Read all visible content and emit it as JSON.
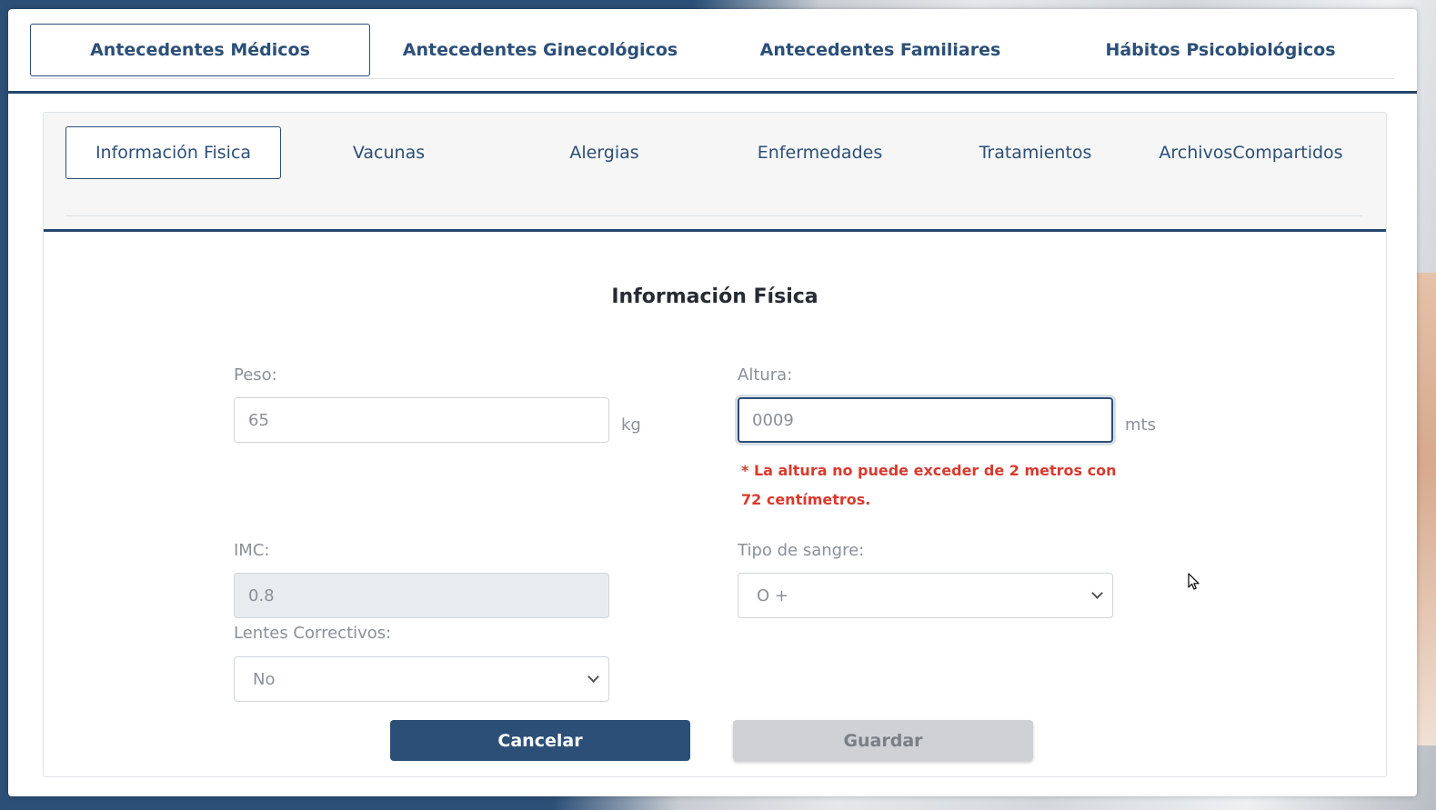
{
  "top_tabs": [
    {
      "label": "Antecedentes Médicos"
    },
    {
      "label": "Antecedentes Ginecológicos"
    },
    {
      "label": "Antecedentes Familiares"
    },
    {
      "label": "Hábitos Psicobiológicos"
    }
  ],
  "sub_tabs": [
    {
      "label": "Información Fisica"
    },
    {
      "label": "Vacunas"
    },
    {
      "label": "Alergias"
    },
    {
      "label": "Enfermedades"
    },
    {
      "label": "Tratamientos"
    },
    {
      "label_line1": "Archivos",
      "label_line2": "Compartidos"
    }
  ],
  "form": {
    "title": "Información Física",
    "peso": {
      "label": "Peso:",
      "value": "65",
      "unit": "kg"
    },
    "altura": {
      "label": "Altura:",
      "value": "0009",
      "unit": "mts"
    },
    "altura_error": "* La altura no puede exceder de 2 metros con 72 centímetros.",
    "imc": {
      "label": "IMC:",
      "value": "0.8"
    },
    "tipo_sangre": {
      "label": "Tipo de sangre:",
      "value": "O +"
    },
    "lentes": {
      "label": "Lentes Correctivos:",
      "value": "No"
    }
  },
  "buttons": {
    "cancel": "Cancelar",
    "save": "Guardar"
  },
  "colors": {
    "primary": "#2c4f77",
    "error": "#d93a2f",
    "disabled_button": "#cfd1d5"
  }
}
